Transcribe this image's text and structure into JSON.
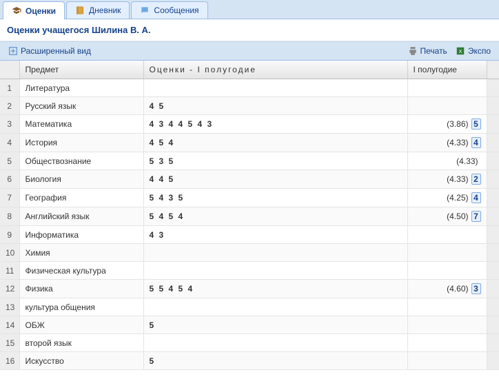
{
  "tabs": [
    {
      "label": "Оценки",
      "active": true,
      "icon": "graduation-cap-icon"
    },
    {
      "label": "Дневник",
      "active": false,
      "icon": "notebook-icon"
    },
    {
      "label": "Сообщения",
      "active": false,
      "icon": "message-icon"
    }
  ],
  "page_title": "Оценки учащегося Шилина В. А.",
  "toolbar": {
    "expanded_view": "Расширенный вид",
    "print": "Печать",
    "export": "Экспо"
  },
  "columns": {
    "num": "",
    "subject": "Предмет",
    "marks": "Оценки - I полугодие",
    "avg": "I полугодие"
  },
  "rows": [
    {
      "n": "1",
      "subject": "Литература",
      "marks": "",
      "avg": "",
      "grade": ""
    },
    {
      "n": "2",
      "subject": "Русский язык",
      "marks": "4 5",
      "avg": "",
      "grade": ""
    },
    {
      "n": "3",
      "subject": "Математика",
      "marks": "4 3 4 4 5 4 3",
      "avg": "(3.86)",
      "grade": "5"
    },
    {
      "n": "4",
      "subject": "История",
      "marks": "4 5 4",
      "avg": "(4.33)",
      "grade": "4"
    },
    {
      "n": "5",
      "subject": "Обществознание",
      "marks": "5 3 5",
      "avg": "(4.33)",
      "grade": ""
    },
    {
      "n": "6",
      "subject": "Биология",
      "marks": "4 4 5",
      "avg": "(4.33)",
      "grade": "2"
    },
    {
      "n": "7",
      "subject": "География",
      "marks": "5 4 3 5",
      "avg": "(4.25)",
      "grade": "4"
    },
    {
      "n": "8",
      "subject": "Английский язык",
      "marks": "5 4 5 4",
      "avg": "(4.50)",
      "grade": "7"
    },
    {
      "n": "9",
      "subject": "Информатика",
      "marks": "4 3",
      "avg": "",
      "grade": ""
    },
    {
      "n": "10",
      "subject": "Химия",
      "marks": "",
      "avg": "",
      "grade": ""
    },
    {
      "n": "11",
      "subject": "Физическая культура",
      "marks": "",
      "avg": "",
      "grade": ""
    },
    {
      "n": "12",
      "subject": "Физика",
      "marks": "5 5 4 5 4",
      "avg": "(4.60)",
      "grade": "3"
    },
    {
      "n": "13",
      "subject": "культура общения",
      "marks": "",
      "avg": "",
      "grade": ""
    },
    {
      "n": "14",
      "subject": "ОБЖ",
      "marks": "5",
      "avg": "",
      "grade": ""
    },
    {
      "n": "15",
      "subject": "второй язык",
      "marks": "",
      "avg": "",
      "grade": ""
    },
    {
      "n": "16",
      "subject": "Искусство",
      "marks": "5",
      "avg": "",
      "grade": ""
    }
  ]
}
